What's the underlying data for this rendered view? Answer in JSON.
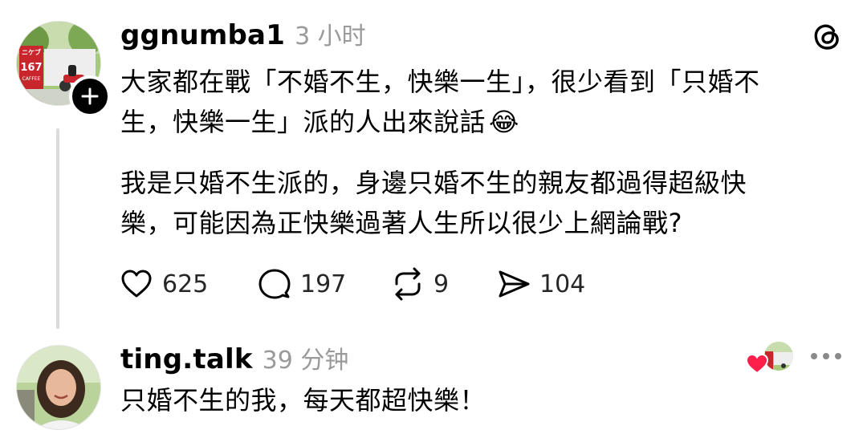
{
  "post": {
    "username": "ggnumba1",
    "time": "3 小时",
    "paragraph1_line1": "大家都在戰「不婚不生，快樂一生」，很少看到「只婚不",
    "paragraph1_line2": "生，快樂一生」派的人出來說話",
    "paragraph1_emoji": "😂",
    "paragraph2_line1": "我是只婚不生派的，身邊只婚不生的親友都過得超級快",
    "paragraph2_line2": "樂，可能因為正快樂過著人生所以很少上網論戰?",
    "avatar_sign_brand": "ニケブ",
    "avatar_sign_number": "167",
    "avatar_sign_sub": "CAFFEE",
    "likes": "625",
    "comments": "197",
    "reposts": "9",
    "shares": "104"
  },
  "reply": {
    "username": "ting.talk",
    "time": "39 分钟",
    "text": "只婚不生的我，每天都超快樂！"
  },
  "icons": {
    "threads_logo": "threads-logo-icon",
    "like": "heart-icon",
    "comment": "comment-bubble-icon",
    "repost": "repost-icon",
    "share": "send-icon",
    "more": "more-icon",
    "follow": "plus-icon",
    "liked_by_author": "heart-filled-icon"
  },
  "colors": {
    "heart_red": "#ff1f4b",
    "text_primary": "#000000",
    "text_secondary": "#9a9a9a",
    "thread_line": "#dcdcdc"
  }
}
